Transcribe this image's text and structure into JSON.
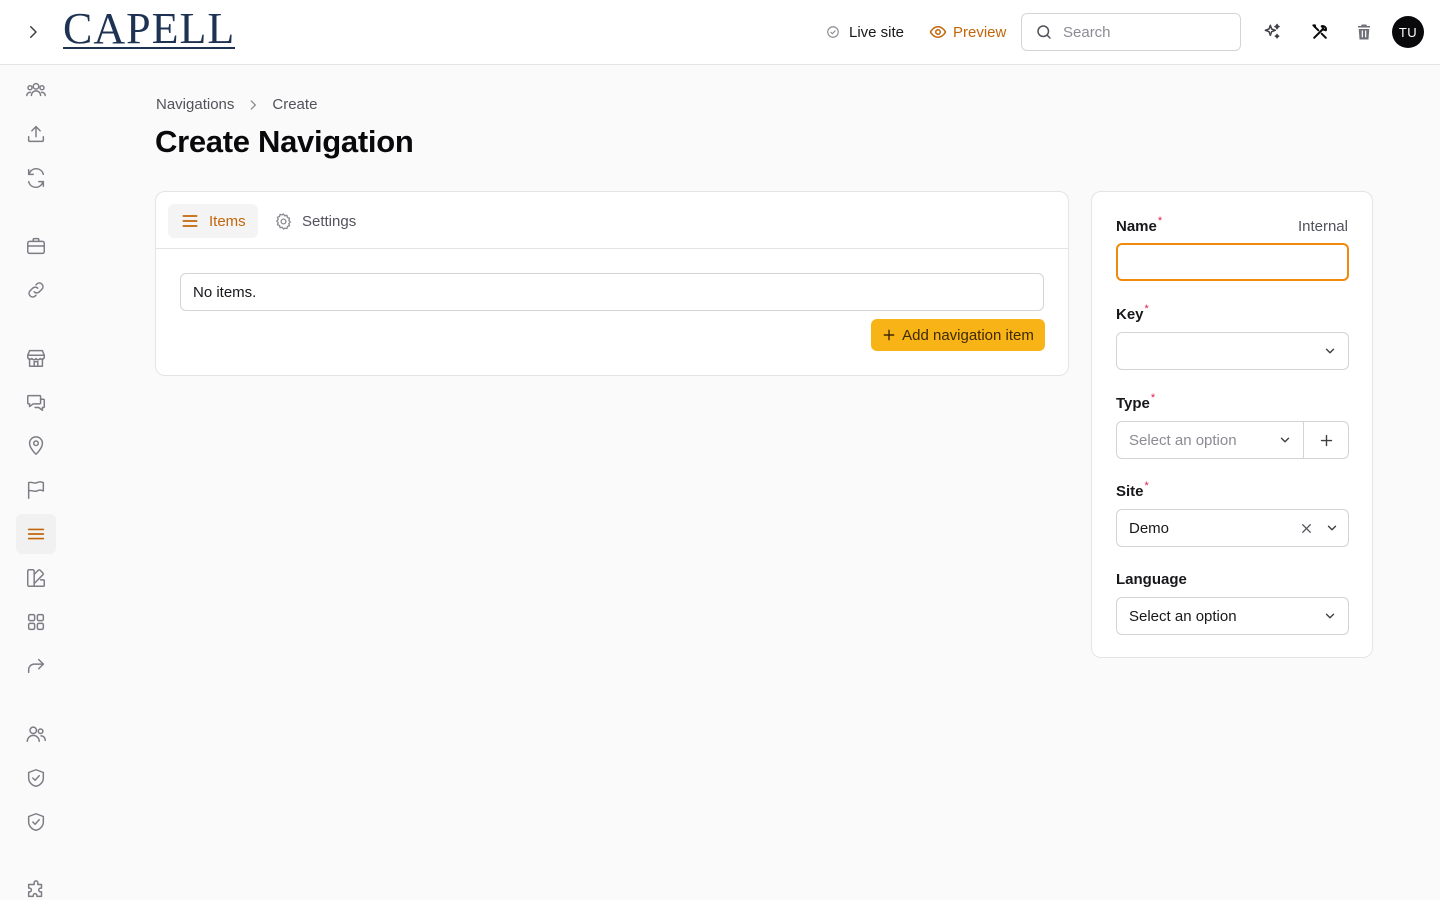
{
  "header": {
    "logo_text": "CAPELL",
    "live_site_label": "Live site",
    "preview_label": "Preview",
    "search_placeholder": "Search",
    "avatar_initials": "TU"
  },
  "breadcrumb": {
    "items": [
      "Navigations",
      "Create"
    ]
  },
  "page": {
    "title": "Create Navigation"
  },
  "tabs": [
    {
      "label": "Items",
      "active": true
    },
    {
      "label": "Settings",
      "active": false
    }
  ],
  "items_panel": {
    "empty_text": "No items.",
    "add_button_label": "Add navigation item"
  },
  "form": {
    "name": {
      "label": "Name",
      "required_marker": "*",
      "hint": "Internal",
      "value": ""
    },
    "key": {
      "label": "Key",
      "required_marker": "*",
      "value": ""
    },
    "type": {
      "label": "Type",
      "required_marker": "*",
      "placeholder": "Select an option"
    },
    "site": {
      "label": "Site",
      "required_marker": "*",
      "value": "Demo"
    },
    "language": {
      "label": "Language",
      "value": "Select an option"
    }
  },
  "sidebar": {
    "icons": [
      "users-group-icon",
      "upload-icon",
      "refresh-icon",
      "briefcase-icon",
      "link-icon",
      "store-icon",
      "chat-icon",
      "map-pin-icon",
      "flag-icon",
      "menu-lines-icon",
      "swatch-icon",
      "grid-icon",
      "share-arrow-icon",
      "users-icon",
      "shield-check-icon",
      "shield-check-icon",
      "puzzle-icon"
    ],
    "active_icon": "menu-lines-icon"
  },
  "colors": {
    "accent": "#c2660a",
    "button_bg": "#f8b416",
    "focus_border": "#f08a0c",
    "required": "#e11d48",
    "logo": "#1e3354"
  }
}
